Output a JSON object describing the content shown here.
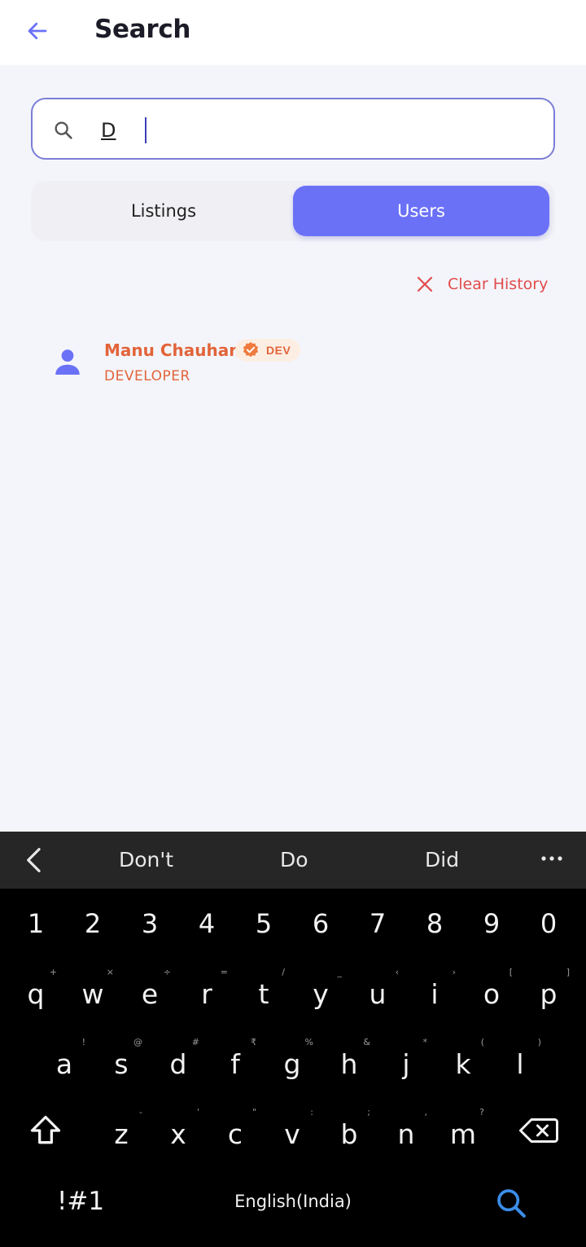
{
  "header": {
    "title": "Search",
    "back_icon": "arrow-left-icon"
  },
  "search": {
    "value": "D",
    "icon": "search-icon"
  },
  "tabs": [
    {
      "label": "Listings",
      "selected": false
    },
    {
      "label": "Users",
      "selected": true
    }
  ],
  "clear_history": {
    "label": "Clear History",
    "icon": "close-icon"
  },
  "results": [
    {
      "name": "Manu Chauhan",
      "badge": "DEV",
      "role": "DEVELOPER",
      "icon": "person-icon"
    }
  ],
  "keyboard": {
    "suggestions": [
      "Don't",
      "Do",
      "Did"
    ],
    "numbers": [
      "1",
      "2",
      "3",
      "4",
      "5",
      "6",
      "7",
      "8",
      "9",
      "0"
    ],
    "row1": [
      {
        "k": "q",
        "s": "+"
      },
      {
        "k": "w",
        "s": "×"
      },
      {
        "k": "e",
        "s": "÷"
      },
      {
        "k": "r",
        "s": "="
      },
      {
        "k": "t",
        "s": "/"
      },
      {
        "k": "y",
        "s": "_"
      },
      {
        "k": "u",
        "s": "‹"
      },
      {
        "k": "i",
        "s": "›"
      },
      {
        "k": "o",
        "s": "["
      },
      {
        "k": "p",
        "s": "]"
      }
    ],
    "row2": [
      {
        "k": "a",
        "s": "!"
      },
      {
        "k": "s",
        "s": "@"
      },
      {
        "k": "d",
        "s": "#"
      },
      {
        "k": "f",
        "s": "₹"
      },
      {
        "k": "g",
        "s": "%"
      },
      {
        "k": "h",
        "s": "&"
      },
      {
        "k": "j",
        "s": "*"
      },
      {
        "k": "k",
        "s": "("
      },
      {
        "k": "l",
        "s": ")"
      }
    ],
    "row3": [
      {
        "k": "z",
        "s": "-"
      },
      {
        "k": "x",
        "s": "'"
      },
      {
        "k": "c",
        "s": "\""
      },
      {
        "k": "v",
        "s": ":"
      },
      {
        "k": "b",
        "s": ";"
      },
      {
        "k": "n",
        "s": ","
      },
      {
        "k": "m",
        "s": "?"
      }
    ],
    "symbols_label": "!#1",
    "space_label": "English(India)",
    "accent_color": "#3b8de8"
  },
  "colors": {
    "accent": "#6a71f7",
    "user_name": "#e2643a",
    "clear_history": "#e14b4b",
    "background": "#f4f5fb"
  }
}
